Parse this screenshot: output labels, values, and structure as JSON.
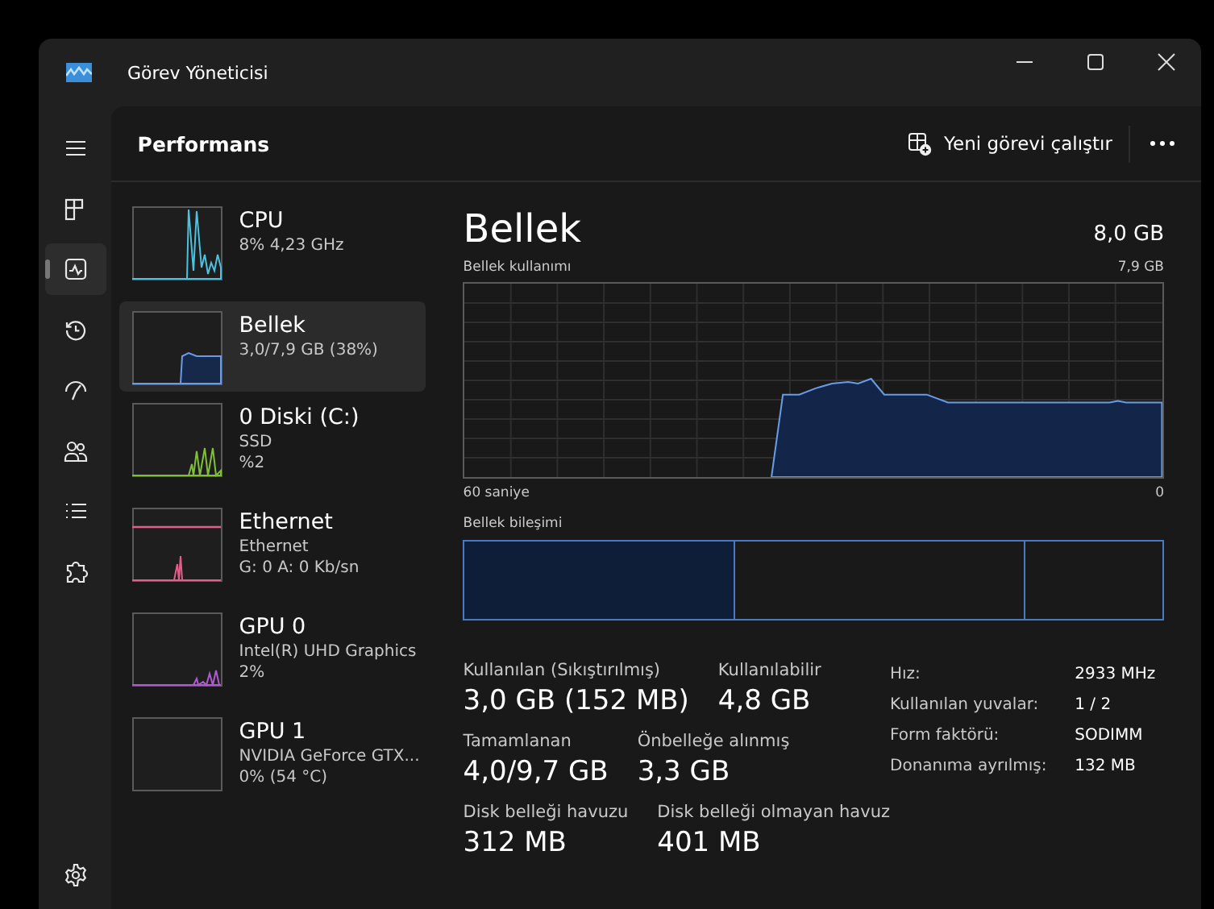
{
  "window": {
    "title": "Görev Yöneticisi"
  },
  "nav": [
    {
      "kind": "processes",
      "selected": false
    },
    {
      "kind": "performance",
      "selected": true
    },
    {
      "kind": "history",
      "selected": false
    },
    {
      "kind": "startup",
      "selected": false
    },
    {
      "kind": "users",
      "selected": false
    },
    {
      "kind": "details",
      "selected": false
    },
    {
      "kind": "services",
      "selected": false
    }
  ],
  "header": {
    "title": "Performans",
    "action": "Yeni görevi çalıştır"
  },
  "resources": [
    {
      "kind": "cpu",
      "name": "CPU",
      "lines": [
        "8%  4,23 GHz"
      ],
      "color": "#4cc2e0",
      "selected": false
    },
    {
      "kind": "memory",
      "name": "Bellek",
      "lines": [
        "3,0/7,9 GB (38%)"
      ],
      "color": "#6a9be8",
      "selected": true
    },
    {
      "kind": "disk",
      "name": "0 Diski (C:)",
      "lines": [
        "SSD",
        "%2"
      ],
      "color": "#7fbf3a",
      "selected": false
    },
    {
      "kind": "network",
      "name": "Ethernet",
      "lines": [
        "Ethernet",
        "G: 0 A: 0 Kb/sn"
      ],
      "color": "#e0608a",
      "selected": false
    },
    {
      "kind": "gpu",
      "name": "GPU 0",
      "lines": [
        "Intel(R) UHD Graphics",
        "2%"
      ],
      "color": "#b05ad0",
      "selected": false
    },
    {
      "kind": "gpu_idle",
      "name": "GPU 1",
      "lines": [
        "NVIDIA GeForce GTX...",
        "0% (54 °C)"
      ],
      "selected": false
    }
  ],
  "detail": {
    "title": "Bellek",
    "total": "8,0 GB",
    "usage_label": "Bellek kullanımı",
    "usage_max": "7,9 GB",
    "axis_start": "60 saniye",
    "axis_end": "0",
    "composition_label": "Bellek bileşimi",
    "stat_rows": [
      [
        {
          "label": "Kullanılan (Sıkıştırılmış)",
          "value": "3,0 GB (152 MB)"
        },
        {
          "label": "Kullanılabilir",
          "value": "4,8 GB"
        }
      ],
      [
        {
          "label": "Tamamlanan",
          "value": "4,0/9,7 GB"
        },
        {
          "label": "Önbelleğe alınmış",
          "value": "3,3 GB"
        }
      ],
      [
        {
          "label": "Disk belleği havuzu",
          "value": "312 MB"
        },
        {
          "label": "Disk belleği olmayan havuz",
          "value": "401 MB"
        }
      ]
    ],
    "specs": [
      {
        "label": "Hız:",
        "value": "2933 MHz"
      },
      {
        "label": "Kullanılan yuvalar:",
        "value": "1 / 2"
      },
      {
        "label": "Form faktörü:",
        "value": "SODIMM"
      },
      {
        "label": "Donanıma ayrılmış:",
        "value": "132 MB"
      }
    ]
  }
}
